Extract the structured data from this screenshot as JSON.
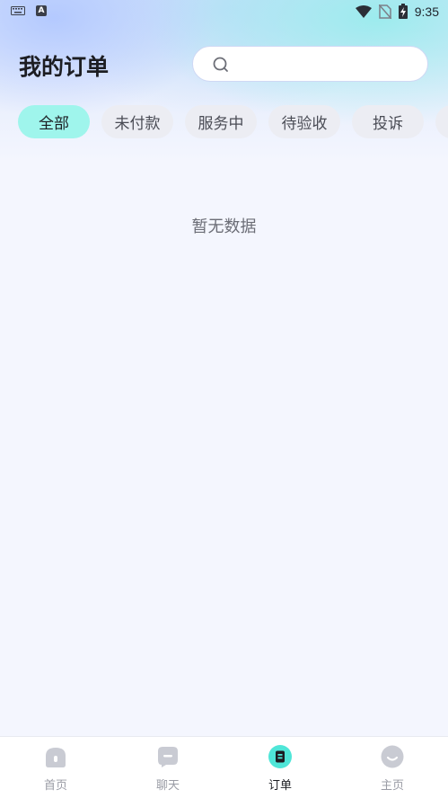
{
  "status_bar": {
    "time": "9:35",
    "keyboard_icon": "keyboard-icon",
    "app_icon_letter": "A",
    "wifi_icon": "wifi-icon",
    "sim_icon": "no-sim-icon",
    "battery_icon": "battery-charging-icon"
  },
  "header": {
    "title": "我的订单",
    "search": {
      "placeholder": "",
      "value": "",
      "icon": "search-icon"
    }
  },
  "tabs": [
    {
      "label": "全部",
      "active": true
    },
    {
      "label": "未付款",
      "active": false
    },
    {
      "label": "服务中",
      "active": false
    },
    {
      "label": "待验收",
      "active": false
    },
    {
      "label": "投诉",
      "active": false
    }
  ],
  "main": {
    "empty_text": "暂无数据"
  },
  "bottom_nav": [
    {
      "label": "首页",
      "icon": "home-icon",
      "active": false
    },
    {
      "label": "聊天",
      "icon": "chat-icon",
      "active": false
    },
    {
      "label": "订单",
      "icon": "order-icon",
      "active": true
    },
    {
      "label": "主页",
      "icon": "profile-icon",
      "active": false
    }
  ],
  "colors": {
    "accent": "#9ff5ec",
    "nav_active_icon": "#4fe6d8",
    "nav_inactive_icon": "#c9cbd3",
    "background": "#f4f6fe"
  }
}
